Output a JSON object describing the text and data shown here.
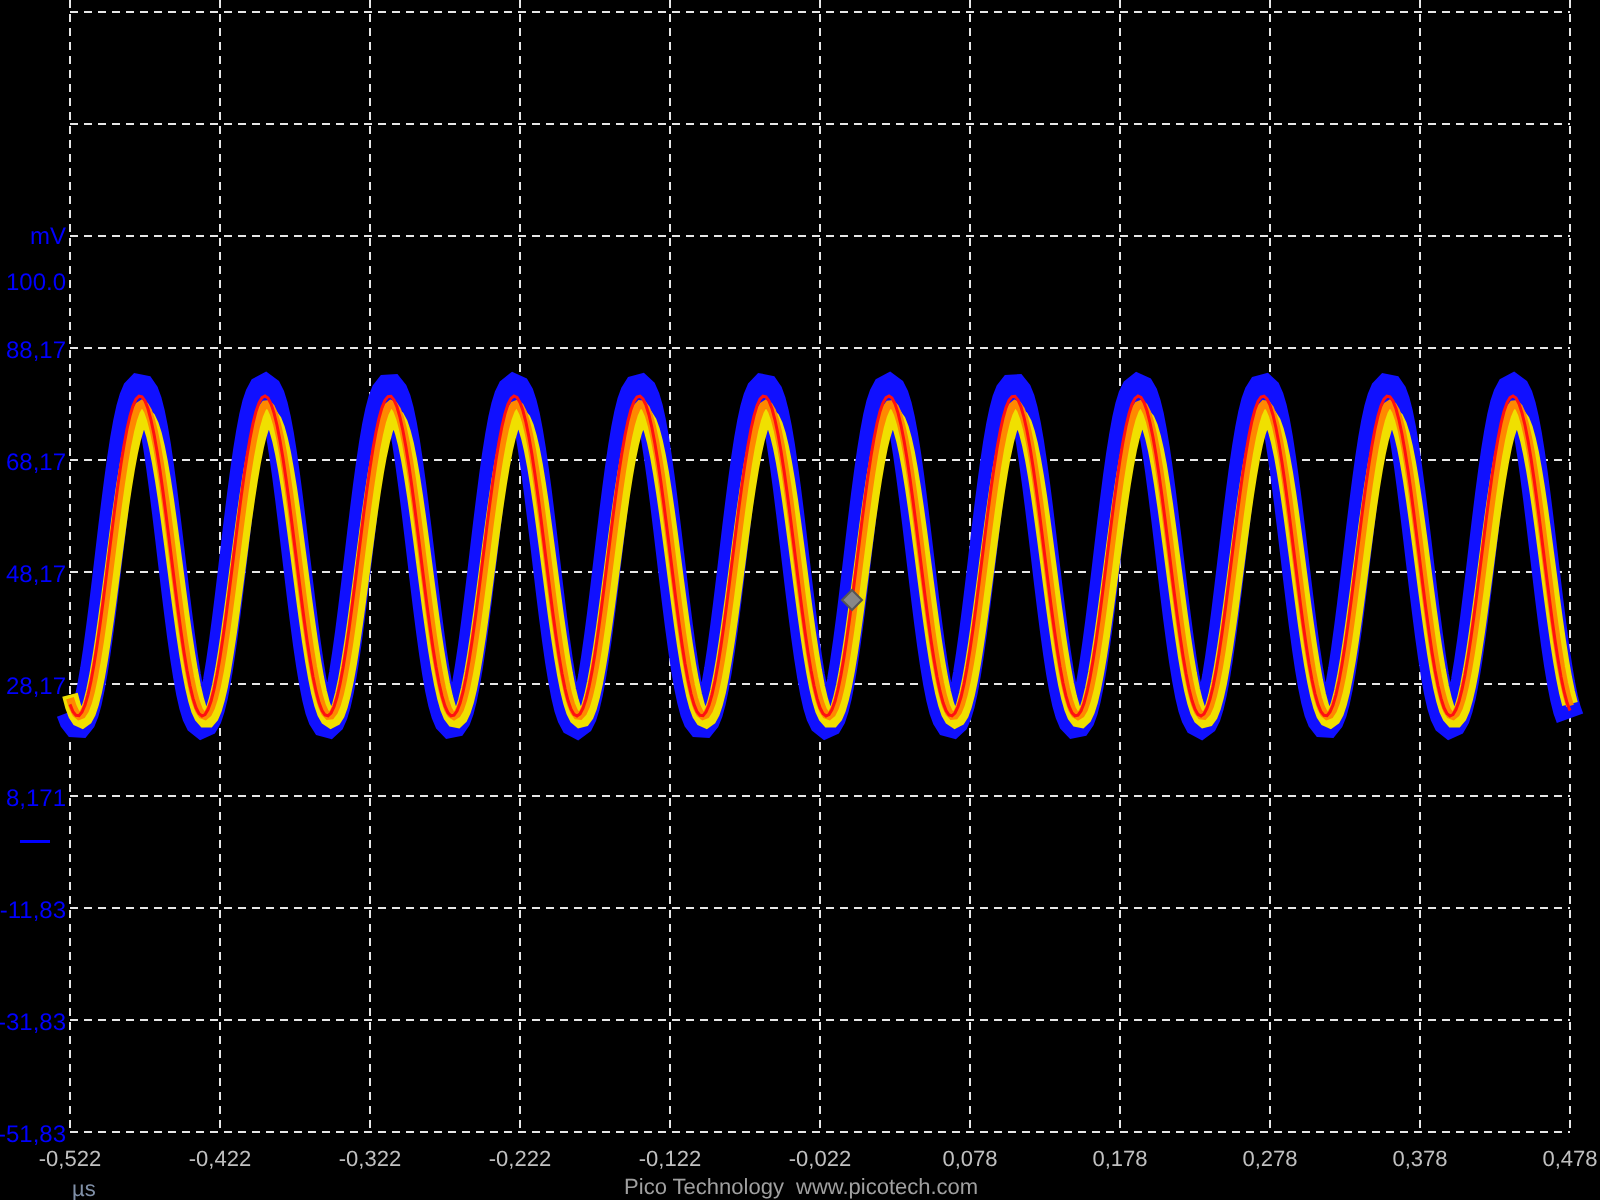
{
  "y_axis": {
    "unit": "mV",
    "top_label": "100.0",
    "labels": [
      "88,17",
      "68,17",
      "48,17",
      "28,17",
      "8,171",
      "-11,83",
      "-31,83",
      "-51,83"
    ]
  },
  "x_axis": {
    "unit": "µs",
    "labels": [
      "-0,522",
      "-0,422",
      "-0,322",
      "-0,222",
      "-0,122",
      "-0,022",
      "0,078",
      "0,178",
      "0,278",
      "0,378",
      "0,478"
    ]
  },
  "footer": {
    "company": "Pico Technology",
    "website": "www.picotech.com"
  }
}
